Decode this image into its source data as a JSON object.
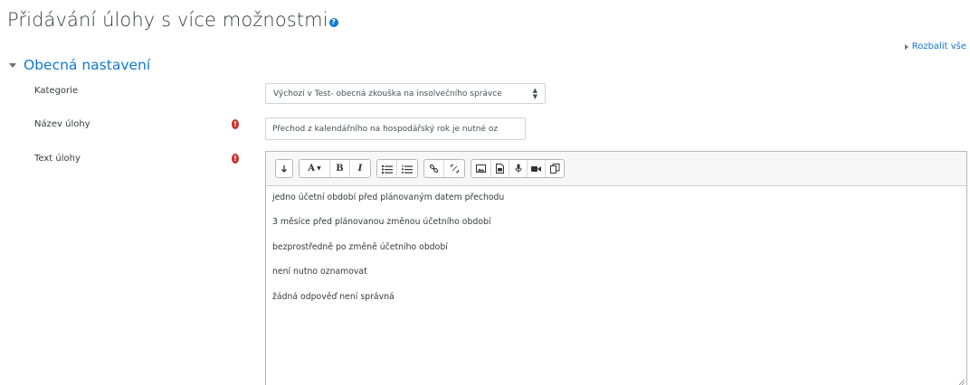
{
  "page": {
    "title": "Přidávání úlohy s více možnostmi"
  },
  "header": {
    "expand_all": "Rozbalit vše"
  },
  "section": {
    "title": "Obecná nastavení"
  },
  "fields": {
    "category": {
      "label": "Kategorie",
      "value": "Výchozí v Test- obecná zkouška na insolvečního správce"
    },
    "question_name": {
      "label": "Název úlohy",
      "value": "Přechod z kalendářního na hospodářský rok je nutné oz"
    },
    "question_text": {
      "label": "Text úlohy",
      "paragraphs": [
        "jedno účetní období před plánovaným datem přechodu",
        "3 měsíce před plánovanou změnou účetního období",
        "bezprostředně po změně účetního období",
        "není nutno oznamovat",
        "žádná odpověď není správná"
      ]
    }
  },
  "toolbar": {
    "font_a": "A",
    "bold": "B",
    "italic": "I"
  },
  "colors": {
    "link": "#1177d1",
    "required": "#c9302c",
    "help": "#1177d1"
  }
}
